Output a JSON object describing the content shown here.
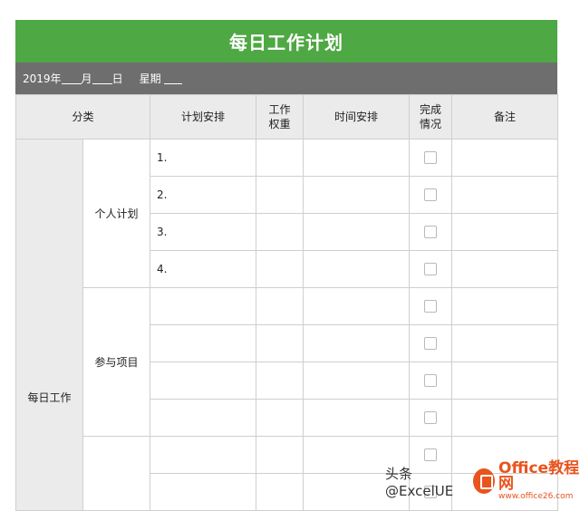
{
  "sheet": {
    "title": "每日工作计划",
    "date_line": {
      "year_label": "2019年",
      "month_label": "月",
      "day_label": "日",
      "weekday_label": "星期"
    }
  },
  "table": {
    "headers": [
      "分类",
      "计划安排",
      "工作\n权重",
      "时间安排",
      "完成\n情况",
      "备注"
    ],
    "category": "每日工作",
    "groups": [
      {
        "name": "个人计划",
        "items": [
          "1.",
          "2.",
          "3.",
          "4."
        ]
      },
      {
        "name": "参与项目",
        "items": [
          "",
          "",
          "",
          ""
        ]
      },
      {
        "name": "",
        "items": [
          "",
          ""
        ]
      }
    ]
  },
  "watermark": {
    "text": "头条 @ExcelUE",
    "brand": "Office教程网",
    "brand_url": "www.office26.com"
  },
  "colors": {
    "title_bg": "#4ea843",
    "date_bg": "#6e6e6e",
    "header_bg": "#ebebeb",
    "border": "#cfcfcf"
  }
}
